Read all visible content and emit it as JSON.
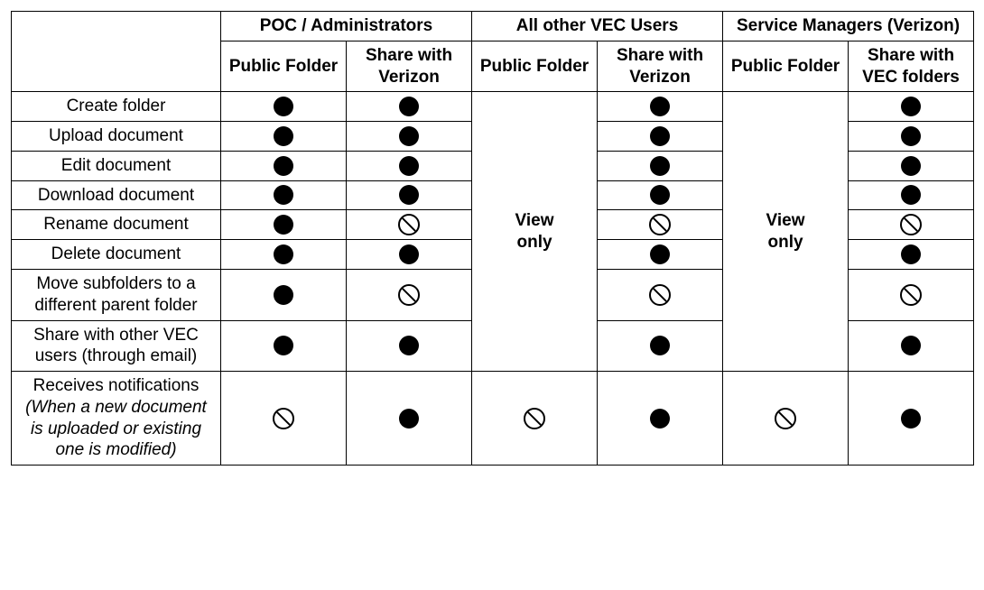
{
  "header": {
    "group1": "POC / Administrators",
    "group2": "All other VEC Users",
    "group3": "Service Managers (Verizon)",
    "sub_public": "Public Folder",
    "sub_share_vz": "Share with Verizon",
    "sub_share_vec": "Share with VEC folders"
  },
  "viewonly_text": "View only",
  "rows": [
    {
      "label": "Create folder",
      "cells": [
        "yes",
        "yes",
        "span",
        "yes",
        "span",
        "yes"
      ]
    },
    {
      "label": "Upload document",
      "cells": [
        "yes",
        "yes",
        null,
        "yes",
        null,
        "yes"
      ]
    },
    {
      "label": "Edit document",
      "cells": [
        "yes",
        "yes",
        null,
        "yes",
        null,
        "yes"
      ]
    },
    {
      "label": "Download document",
      "cells": [
        "yes",
        "yes",
        null,
        "yes",
        null,
        "yes"
      ]
    },
    {
      "label": "Rename document",
      "cells": [
        "yes",
        "no",
        null,
        "no",
        null,
        "no"
      ]
    },
    {
      "label": "Delete document",
      "cells": [
        "yes",
        "yes",
        null,
        "yes",
        null,
        "yes"
      ]
    },
    {
      "label": "Move subfolders to a different parent folder",
      "cells": [
        "yes",
        "no",
        null,
        "no",
        null,
        "no"
      ]
    },
    {
      "label": "Share with other VEC users (through email)",
      "cells": [
        "yes",
        "yes",
        null,
        "yes",
        null,
        "yes"
      ]
    },
    {
      "label": "Receives notifications",
      "label_suffix_italic": "(When a new document is uploaded or existing one is modified)",
      "cells": [
        "no",
        "yes",
        "no",
        "yes",
        "no",
        "yes"
      ]
    }
  ]
}
